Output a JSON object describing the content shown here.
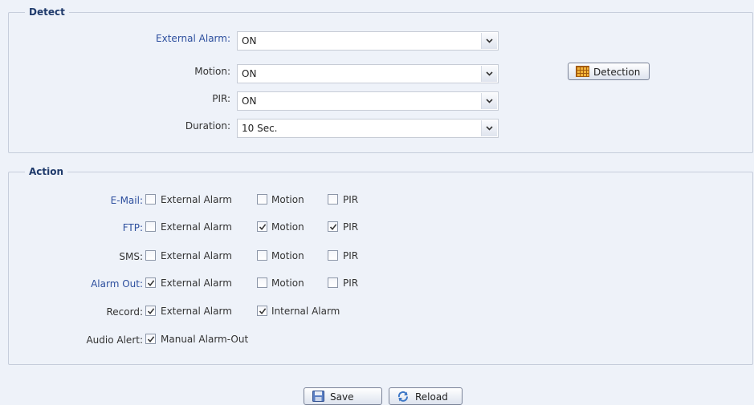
{
  "detect": {
    "legend": "Detect",
    "detection_button": "Detection",
    "rows": [
      {
        "label": "External Alarm:",
        "value": "ON"
      },
      {
        "label": "Motion:",
        "value": "ON"
      },
      {
        "label": "PIR:",
        "value": "ON"
      },
      {
        "label": "Duration:",
        "value": "10 Sec."
      }
    ]
  },
  "action": {
    "legend": "Action",
    "rows": [
      {
        "label": "E-Mail:",
        "options": [
          {
            "label": "External Alarm",
            "checked": false
          },
          {
            "label": "Motion",
            "checked": false
          },
          {
            "label": "PIR",
            "checked": false
          }
        ]
      },
      {
        "label": "FTP:",
        "options": [
          {
            "label": "External Alarm",
            "checked": false
          },
          {
            "label": "Motion",
            "checked": true
          },
          {
            "label": "PIR",
            "checked": true
          }
        ]
      },
      {
        "label": "SMS:",
        "options": [
          {
            "label": "External Alarm",
            "checked": false
          },
          {
            "label": "Motion",
            "checked": false
          },
          {
            "label": "PIR",
            "checked": false
          }
        ]
      },
      {
        "label": "Alarm Out:",
        "options": [
          {
            "label": "External Alarm",
            "checked": true
          },
          {
            "label": "Motion",
            "checked": false
          },
          {
            "label": "PIR",
            "checked": false
          }
        ]
      },
      {
        "label": "Record:",
        "options": [
          {
            "label": "External Alarm",
            "checked": true
          },
          {
            "label": "Internal Alarm",
            "checked": true
          }
        ]
      },
      {
        "label": "Audio Alert:",
        "options": [
          {
            "label": "Manual Alarm-Out",
            "checked": true
          }
        ]
      }
    ]
  },
  "footer": {
    "save_label": "Save",
    "reload_label": "Reload"
  },
  "colors": {
    "background": "#eef2f9",
    "legend_text": "#1f3a6b",
    "link_label": "#2d4f9e",
    "border": "#c6cddb"
  }
}
